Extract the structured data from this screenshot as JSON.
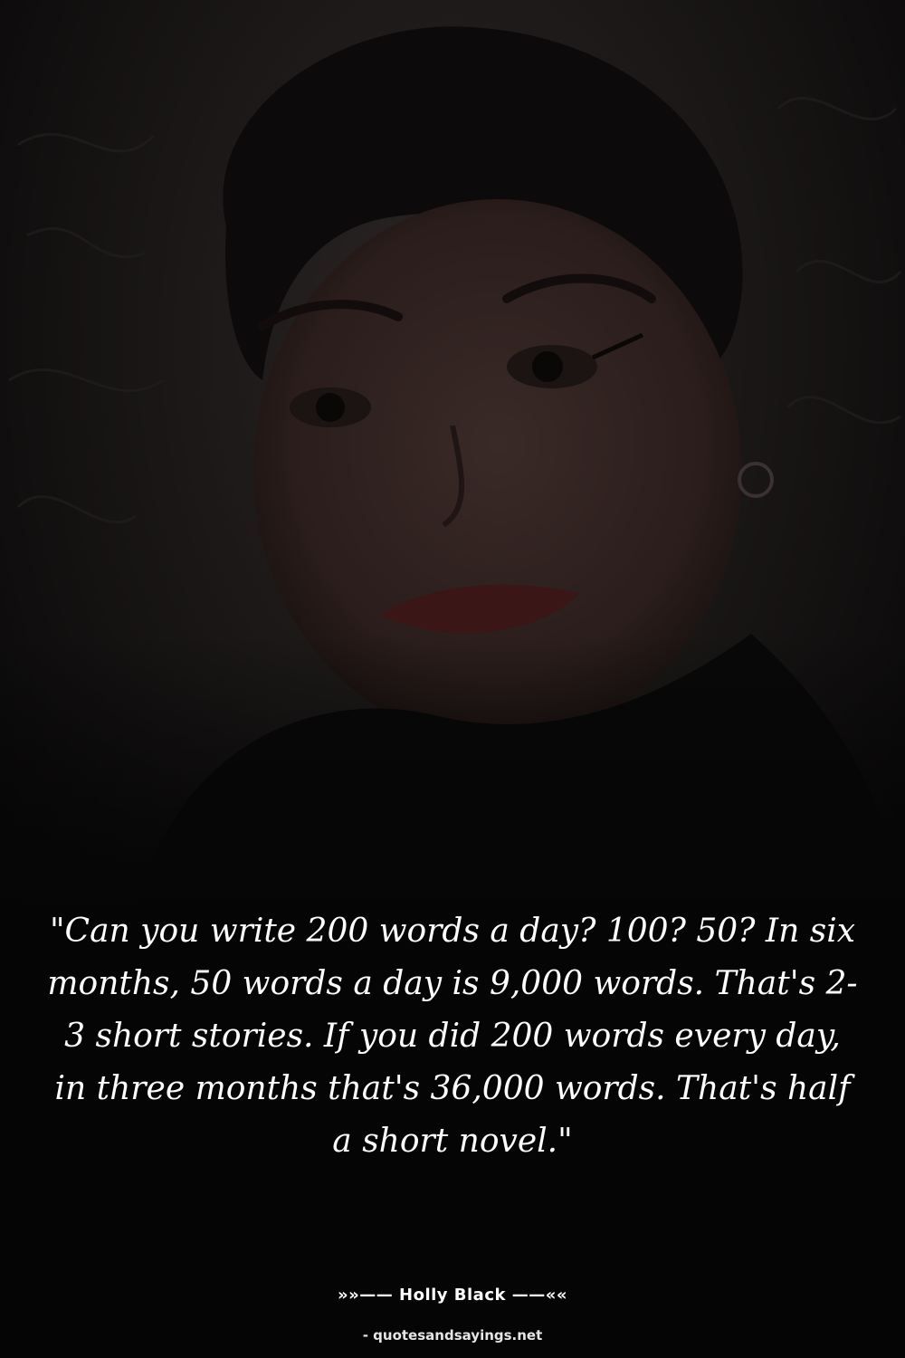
{
  "quote": {
    "text": "\"Can you write 200 words a day? 100? 50? In six months, 50 words a day is 9,000 words. That's 2-3 short stories. If you did 200 words every day, in three months that's 36,000 words. That's half a short novel.\""
  },
  "attribution": {
    "author_line": "»»—— Holly Black ——««"
  },
  "footer": {
    "site": "- quotesandsayings.net"
  },
  "colors": {
    "background": "#050505",
    "text": "#ffffff"
  }
}
